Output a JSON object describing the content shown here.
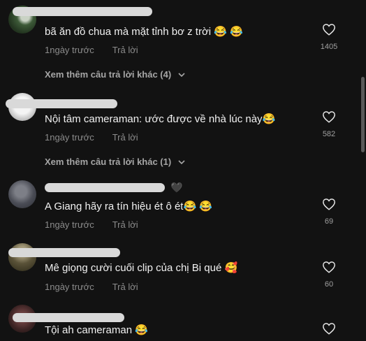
{
  "comments": [
    {
      "username": "",
      "text": "bã ăn đồ chua mà mặt tỉnh bơ z trời 😂 😂",
      "time": "1ngày trước",
      "reply": "Trả lời",
      "likes": "1405",
      "more": "Xem thêm câu trả lời khác (4)"
    },
    {
      "username": "",
      "text": "Nội tâm cameraman: ước được về nhà lúc này😂",
      "time": "1ngày trước",
      "reply": "Trả lời",
      "likes": "582",
      "more": "Xem thêm câu trả lời khác (1)"
    },
    {
      "username": "",
      "text": "A Giang hãy ra tín hiệu ét ô ét😂 😂",
      "time": "1ngày trước",
      "reply": "Trả lời",
      "likes": "69",
      "badge": "🖤"
    },
    {
      "username": "",
      "text": "Mê giọng cười cuối clip của chị Bi qué 🥰",
      "time": "1ngày trước",
      "reply": "Trả lời",
      "likes": "60"
    },
    {
      "username": "",
      "text": "Tội ah cameraman 😂",
      "likes": ""
    }
  ],
  "icons": {
    "like": "heart-outline-icon",
    "expand": "chevron-down-icon"
  },
  "colors": {
    "background": "#121212",
    "muted": "#8b8b8b"
  }
}
